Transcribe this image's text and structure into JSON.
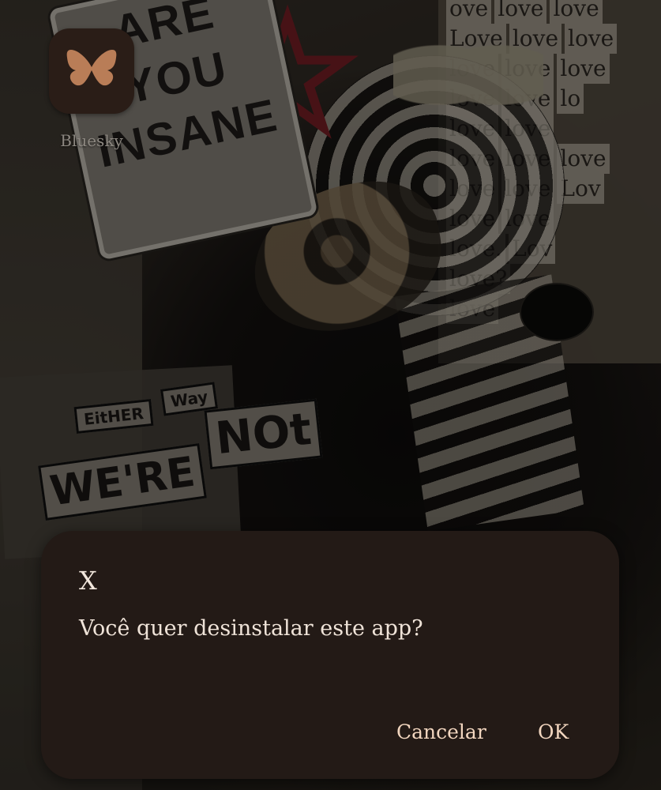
{
  "home_screen": {
    "app": {
      "label": "Bluesky",
      "icon": "butterfly-icon",
      "icon_color": "#b97d57",
      "tile_color": "#2a1d17"
    },
    "wallpaper": {
      "sign_lines": [
        "ARE",
        "YOU",
        "INSANE"
      ],
      "ransom_words": [
        "EitHER",
        "Way",
        "WE'RE",
        "NOt"
      ],
      "love_rows": [
        "ove love love",
        "Love love love",
        "love love love",
        "love love lo",
        "love love",
        "love love love",
        "love love Lov",
        "love love",
        "love. Lov",
        "love?",
        "love"
      ]
    }
  },
  "dialog": {
    "title": "X",
    "message": "Você quer desinstalar este app?",
    "cancel_label": "Cancelar",
    "ok_label": "OK",
    "background": "#231a16",
    "button_color": "#f2d6bf"
  }
}
